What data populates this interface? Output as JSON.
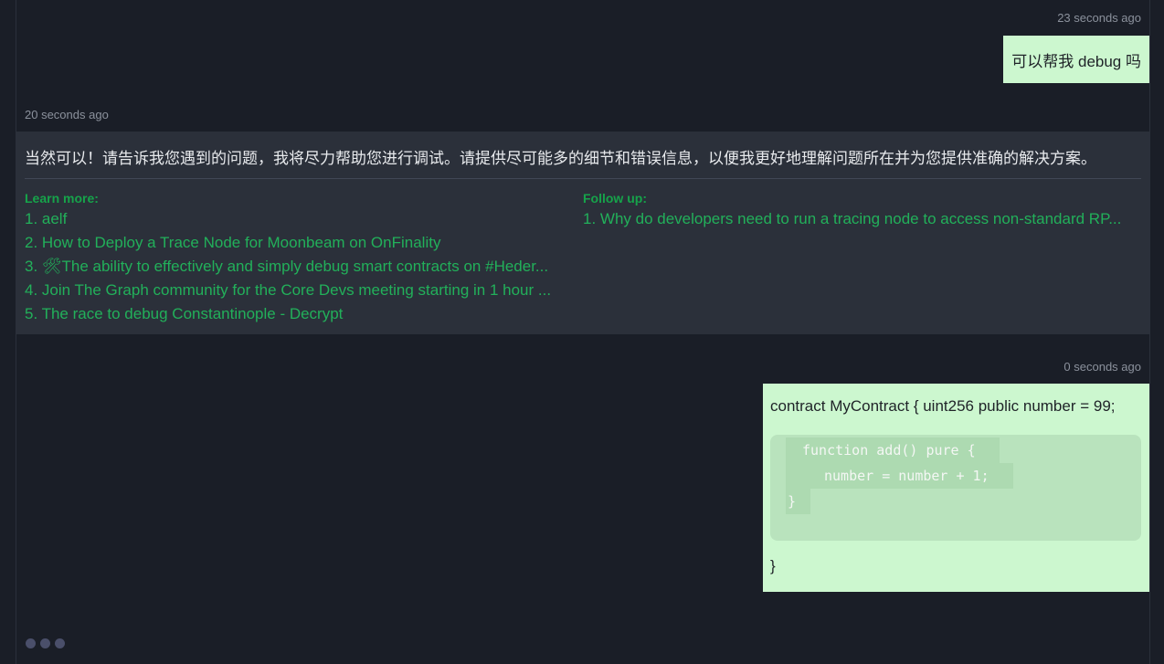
{
  "messages": {
    "user_1": {
      "time": "23 seconds ago",
      "text": "可以帮我 debug 吗"
    },
    "bot_1": {
      "time": "20 seconds ago",
      "text": "当然可以！请告诉我您遇到的问题，我将尽力帮助您进行调试。请提供尽可能多的细节和错误信息，以便我更好地理解问题所在并为您提供准确的解决方案。",
      "learn_more_title": "Learn more:",
      "learn_more": [
        "1. aelf",
        "2. How to Deploy a Trace Node for Moonbeam on OnFinality",
        "3. 🛠The ability to effectively and simply debug smart contracts on #Heder...",
        "4. Join The Graph community for the Core Devs meeting starting in 1 hour ...",
        "5. The race to debug Constantinople - Decrypt"
      ],
      "follow_up_title": "Follow up:",
      "follow_up": [
        "1. Why do developers need to run a tracing node to access non-standard RP..."
      ]
    },
    "user_2": {
      "time": "0 seconds ago",
      "head": "contract MyContract { uint256 public number = 99;",
      "code_lines": [
        "function add() pure {",
        "number = number + 1;",
        "}"
      ],
      "tail": "}"
    }
  },
  "colors": {
    "background": "#1a1e27",
    "user_bubble": "#ccf7cf",
    "bot_bubble": "#2b303a",
    "link": "#22b05a"
  }
}
